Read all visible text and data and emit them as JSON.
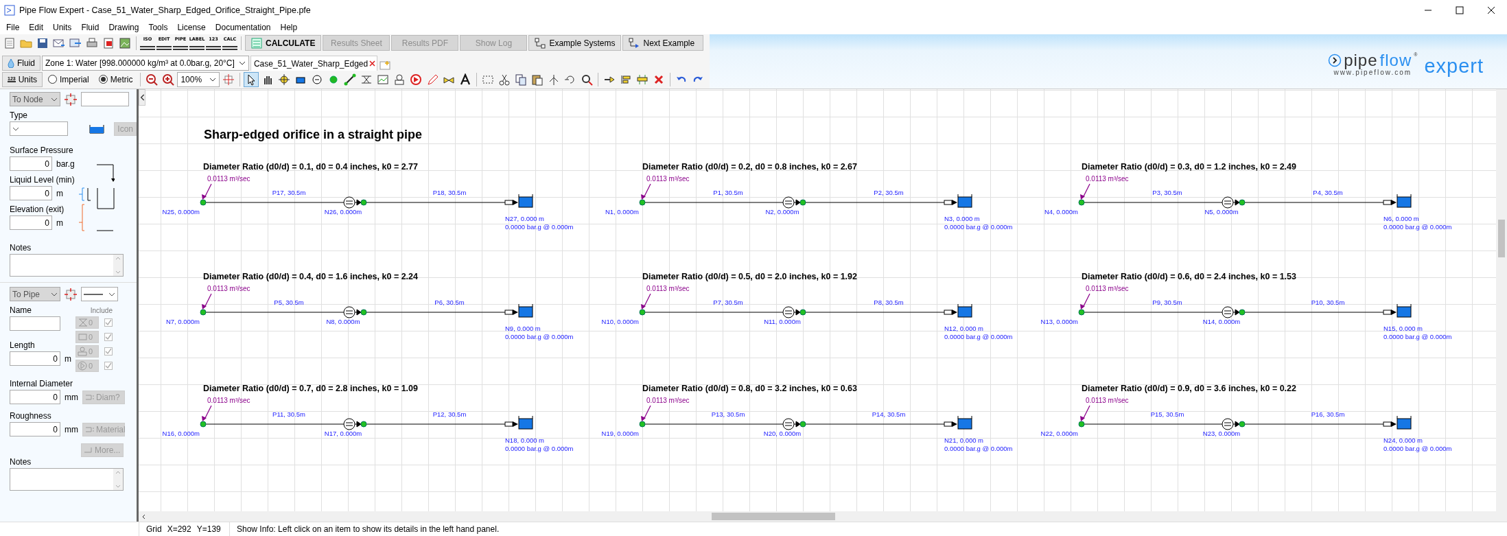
{
  "window": {
    "title": "Pipe Flow Expert - Case_51_Water_Sharp_Edged_Orifice_Straight_Pipe.pfe"
  },
  "menu": [
    "File",
    "Edit",
    "Units",
    "Fluid",
    "Drawing",
    "Tools",
    "License",
    "Documentation",
    "Help"
  ],
  "toolbar": {
    "mode_buttons": [
      "ISO",
      "EDIT",
      "PIPE",
      "LABEL",
      "123",
      "CALC"
    ],
    "buttons": [
      {
        "label": "CALCULATE",
        "disabled": false,
        "kind": "calculate"
      },
      {
        "label": "Results Sheet",
        "disabled": true,
        "kind": "plain"
      },
      {
        "label": "Results PDF",
        "disabled": true,
        "kind": "plain"
      },
      {
        "label": "Show Log",
        "disabled": true,
        "kind": "plain"
      },
      {
        "label": "Example Systems",
        "disabled": false,
        "kind": "examples"
      },
      {
        "label": "Next Example",
        "disabled": false,
        "kind": "next"
      }
    ]
  },
  "fluid_bar": {
    "fluid_button": "Fluid",
    "zone": "Zone 1: Water [998.000000 kg/m³ at 0.0bar.g, 20°C]",
    "tab": {
      "label": "Case_51_Water_Sharp_Edged",
      "selected": true
    }
  },
  "units_bar": {
    "units_icon_text": "123",
    "units_button": "Units",
    "systems": [
      {
        "label": "Imperial",
        "selected": false
      },
      {
        "label": "Metric",
        "selected": true
      }
    ],
    "zoom": "100%",
    "pointer_tool": {
      "selected": true
    }
  },
  "logo": {
    "pipe": "pipe",
    "flow": "flow",
    "mark": "®",
    "expert": "expert",
    "url": "www.pipeflow.com"
  },
  "node_panel": {
    "to_node": "To Node",
    "type_label": "Type",
    "icon_button": "Icon",
    "fields": [
      {
        "label": "Surface Pressure",
        "value": "0",
        "unit": "bar.g"
      },
      {
        "label": "Liquid Level (min)",
        "value": "0",
        "unit": "m"
      },
      {
        "label": "Elevation (exit)",
        "value": "0",
        "unit": "m"
      }
    ],
    "notes_label": "Notes"
  },
  "pipe_panel": {
    "to_pipe": "To Pipe",
    "name_label": "Name",
    "include_label": "Include",
    "fittings": [
      {
        "count": "0",
        "checked": true
      },
      {
        "count": "0",
        "checked": true
      },
      {
        "count": "0",
        "checked": true
      },
      {
        "count": "0",
        "checked": true
      }
    ],
    "length": {
      "label": "Length",
      "value": "0",
      "unit": "m"
    },
    "internal_diameter": {
      "label": "Internal Diameter",
      "value": "0",
      "unit": "mm",
      "button": "Diam?"
    },
    "roughness": {
      "label": "Roughness",
      "value": "0",
      "unit": "mm",
      "button": "Material"
    },
    "more_button": "More...",
    "notes_label": "Notes"
  },
  "drawing": {
    "title": "Sharp-edged orifice in a straight pipe",
    "systems": [
      {
        "title": "Diameter Ratio (d0/d) = 0.1, d0 = 0.4 inches, k0 = 2.77",
        "flow": "0.0113 m³/sec",
        "pipes": [
          "P17, 30.5m",
          "P18, 30.5m"
        ],
        "start_node": "N25, 0.000m",
        "orifice_node": "N26, 0.000m",
        "end_node": "N27, 0.000 m",
        "end_pressure": "0.0000 bar.g @ 0.000m"
      },
      {
        "title": "Diameter Ratio (d0/d) = 0.2, d0 = 0.8 inches, k0 = 2.67",
        "flow": "0.0113 m³/sec",
        "pipes": [
          "P1, 30.5m",
          "P2, 30.5m"
        ],
        "start_node": "N1, 0.000m",
        "orifice_node": "N2, 0.000m",
        "end_node": "N3, 0.000 m",
        "end_pressure": "0.0000 bar.g @ 0.000m"
      },
      {
        "title": "Diameter Ratio (d0/d) = 0.3, d0 = 1.2 inches, k0 = 2.49",
        "flow": "0.0113 m³/sec",
        "pipes": [
          "P3, 30.5m",
          "P4, 30.5m"
        ],
        "start_node": "N4, 0.000m",
        "orifice_node": "N5, 0.000m",
        "end_node": "N6, 0.000 m",
        "end_pressure": "0.0000 bar.g @ 0.000m"
      },
      {
        "title": "Diameter Ratio (d0/d) = 0.4, d0 = 1.6 inches, k0 = 2.24",
        "flow": "0.0113 m³/sec",
        "pipes": [
          "P5, 30.5m",
          "P6, 30.5m"
        ],
        "start_node": "N7, 0.000m",
        "orifice_node": "N8, 0.000m",
        "end_node": "N9, 0.000 m",
        "end_pressure": "0.0000 bar.g @ 0.000m"
      },
      {
        "title": "Diameter Ratio (d0/d) = 0.5, d0 = 2.0 inches, k0 = 1.92",
        "flow": "0.0113 m³/sec",
        "pipes": [
          "P7, 30.5m",
          "P8, 30.5m"
        ],
        "start_node": "N10, 0.000m",
        "orifice_node": "N11, 0.000m",
        "end_node": "N12, 0.000 m",
        "end_pressure": "0.0000 bar.g @ 0.000m"
      },
      {
        "title": "Diameter Ratio (d0/d) = 0.6, d0 = 2.4 inches, k0 = 1.53",
        "flow": "0.0113 m³/sec",
        "pipes": [
          "P9, 30.5m",
          "P10, 30.5m"
        ],
        "start_node": "N13, 0.000m",
        "orifice_node": "N14, 0.000m",
        "end_node": "N15, 0.000 m",
        "end_pressure": "0.0000 bar.g @ 0.000m"
      },
      {
        "title": "Diameter Ratio (d0/d) = 0.7, d0 = 2.8 inches, k0 = 1.09",
        "flow": "0.0113 m³/sec",
        "pipes": [
          "P11, 30.5m",
          "P12, 30.5m"
        ],
        "start_node": "N16, 0.000m",
        "orifice_node": "N17, 0.000m",
        "end_node": "N18, 0.000 m",
        "end_pressure": "0.0000 bar.g @ 0.000m"
      },
      {
        "title": "Diameter Ratio (d0/d) = 0.8, d0 = 3.2 inches, k0 = 0.63",
        "flow": "0.0113 m³/sec",
        "pipes": [
          "P13, 30.5m",
          "P14, 30.5m"
        ],
        "start_node": "N19, 0.000m",
        "orifice_node": "N20, 0.000m",
        "end_node": "N21, 0.000 m",
        "end_pressure": "0.0000 bar.g @ 0.000m"
      },
      {
        "title": "Diameter Ratio (d0/d) = 0.9, d0 = 3.6 inches, k0 = 0.22",
        "flow": "0.0113 m³/sec",
        "pipes": [
          "P15, 30.5m",
          "P16, 30.5m"
        ],
        "start_node": "N22, 0.000m",
        "orifice_node": "N23, 0.000m",
        "end_node": "N24, 0.000 m",
        "end_pressure": "0.0000 bar.g @ 0.000m"
      }
    ]
  },
  "status_bar": {
    "grid": "Grid",
    "x": "X=292",
    "y": "Y=139",
    "info": "Show Info: Left click on an item to show its details in the left hand panel."
  }
}
